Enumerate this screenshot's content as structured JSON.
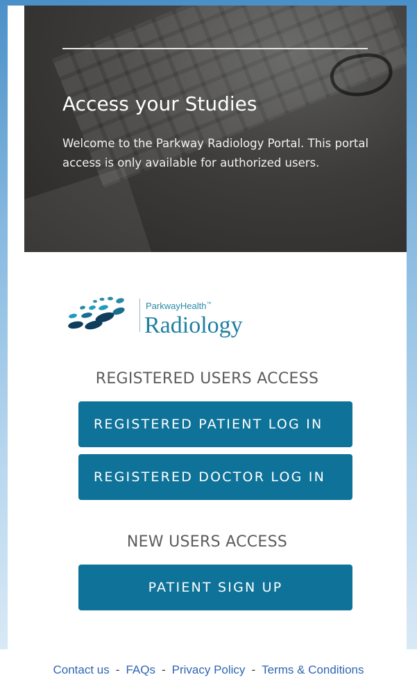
{
  "hero": {
    "title": "Access your Studies",
    "description": "Welcome to the Parkway Radiology Portal. This portal access is only available for authorized users."
  },
  "logo": {
    "brand_small": "ParkwayHealth",
    "trademark": "™",
    "brand_big": "Radiology"
  },
  "registered": {
    "heading": "REGISTERED USERS ACCESS",
    "patient_login": "REGISTERED PATIENT LOG IN",
    "doctor_login": "REGISTERED DOCTOR LOG IN"
  },
  "new_users": {
    "heading": "NEW USERS ACCESS",
    "signup": "PATIENT SIGN UP"
  },
  "footer": {
    "contact": "Contact us",
    "faqs": "FAQs",
    "privacy": "Privacy Policy",
    "terms": "Terms & Conditions",
    "separator": "-"
  },
  "colors": {
    "button": "#0f7399",
    "link": "#2f66b3",
    "brand": "#1e7fa0"
  }
}
